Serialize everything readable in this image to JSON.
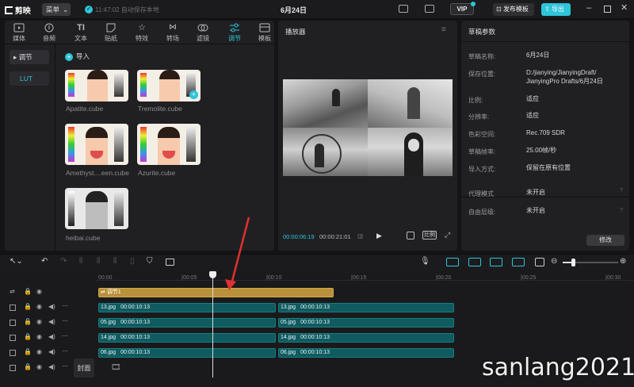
{
  "topbar": {
    "app_name": "剪映",
    "menu_label": "菜单",
    "autosave_text": "11:47:02 自动保存本地",
    "project_title": "6月24日",
    "vip_label": "VIP",
    "publish_template_label": "发布模板",
    "export_label": "导出"
  },
  "media_tabs": [
    "媒体",
    "音频",
    "文本",
    "贴纸",
    "特效",
    "转场",
    "滤镜",
    "调节",
    "模板"
  ],
  "media_sidebar": {
    "item_adjust": "调节",
    "item_lut": "LUT"
  },
  "import_label": "导入",
  "luts": [
    {
      "name": "Apatite.cube"
    },
    {
      "name": "Tremolite.cube"
    },
    {
      "name": "Amethyst....een.cube"
    },
    {
      "name": "Azurite.cube"
    },
    {
      "name": "heibai.cube"
    }
  ],
  "player": {
    "title": "播放器",
    "current_time": "00:00:06:19",
    "total_time": "00:00:21:01",
    "ratio_label": "比例"
  },
  "draft": {
    "title": "草稿参数",
    "fields": [
      {
        "label": "草稿名称:",
        "value": "6月24日"
      },
      {
        "label": "保存位置:",
        "value": "D:/jianying/JianyingDraft/\nJianyingPro Drafts/6月24日"
      },
      {
        "label": "比例:",
        "value": "适应"
      },
      {
        "label": "分辨率:",
        "value": "适应"
      },
      {
        "label": "色彩空间:",
        "value": "Rec.709 SDR"
      },
      {
        "label": "草稿帧率:",
        "value": "25.00帧/秒"
      },
      {
        "label": "导入方式:",
        "value": "保留在原有位置"
      },
      {
        "label": "代理模式",
        "value": "未开启"
      },
      {
        "label": "自由层级:",
        "value": "未开启"
      }
    ],
    "edit_label": "修改"
  },
  "timeline": {
    "ticks": [
      "00:00",
      "|00:05",
      "|00:10",
      "|00:15",
      "|00:20",
      "|00:25",
      "|00:30"
    ],
    "adjust_clip": "调节1",
    "clips": [
      [
        {
          "name": "13.jpg",
          "dur": "00:00:10:13"
        },
        {
          "name": "13.jpg",
          "dur": "00:00:10:13"
        }
      ],
      [
        {
          "name": "05.jpg",
          "dur": "00:00:10:13"
        },
        {
          "name": "05.jpg",
          "dur": "00:00:10:13"
        }
      ],
      [
        {
          "name": "14.jpg",
          "dur": "00:00:10:13"
        },
        {
          "name": "14.jpg",
          "dur": "00:00:10:13"
        }
      ],
      [
        {
          "name": "06.jpg",
          "dur": "00:00:10:13"
        },
        {
          "name": "06.jpg",
          "dur": "00:00:10:13"
        }
      ]
    ],
    "cover_label": "封面"
  },
  "watermark": "sanlang2021",
  "colors": {
    "accent": "#2ec4d9",
    "adjust_clip": "#b8913a",
    "clip": "#0f5b60",
    "arrow": "#e03030"
  }
}
